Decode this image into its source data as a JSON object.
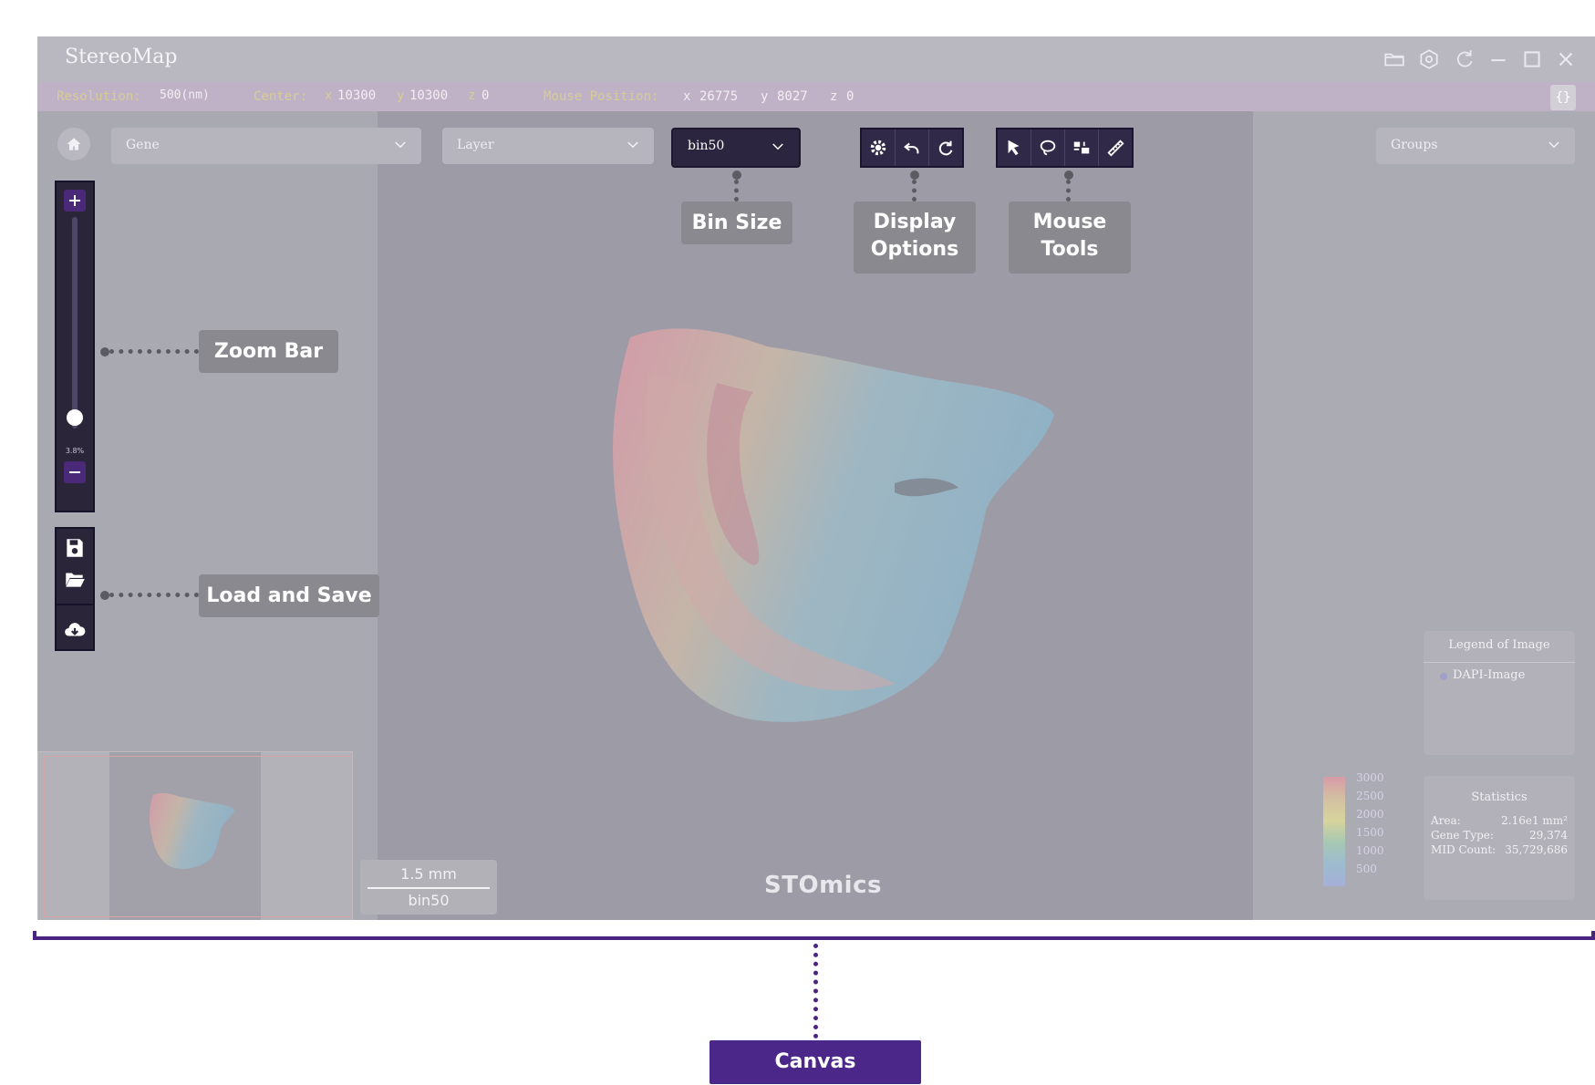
{
  "app": {
    "title": "StereoMap"
  },
  "status": {
    "resolution_label": "Resolution:",
    "resolution_value": "500(nm)",
    "center_label": "Center:",
    "center_x_label": "x",
    "center_x": "10300",
    "center_y_label": "y",
    "center_y": "10300",
    "center_z_label": "z",
    "center_z": "0",
    "mouse_label": "Mouse Position:",
    "mouse_x_label": "x",
    "mouse_x": "26775",
    "mouse_y_label": "y",
    "mouse_y": "8027",
    "mouse_z_label": "z",
    "mouse_z": "0",
    "expand_icon": "{}"
  },
  "toolbar": {
    "gene_label": "Gene",
    "layer_label": "Layer",
    "bin_value": "bin50",
    "groups_label": "Groups"
  },
  "zoom": {
    "percent": "3.8%",
    "level": 0.05
  },
  "scalebar": {
    "length": "1.5 mm",
    "bin": "bin50"
  },
  "wordmark": "STOmics",
  "legend": {
    "title": "Legend of Image",
    "items": [
      "DAPI-Image"
    ]
  },
  "colorbar": {
    "ticks": [
      "3000",
      "2500",
      "2000",
      "1500",
      "1000",
      "500"
    ]
  },
  "statistics": {
    "title": "Statistics",
    "rows": [
      {
        "label": "Area:",
        "value": "2.16e1 mm²"
      },
      {
        "label": "Gene Type:",
        "value": "29,374"
      },
      {
        "label": "MID Count:",
        "value": "35,729,686"
      }
    ]
  },
  "annotations": {
    "bin_size": "Bin Size",
    "display_options_1": "Display",
    "display_options_2": "Options",
    "mouse_tools_1": "Mouse",
    "mouse_tools_2": "Tools",
    "zoom_bar": "Zoom Bar",
    "load_save": "Load and Save",
    "canvas": "Canvas"
  },
  "colors": {
    "accent": "#4b2789",
    "toolbar_dark": "#302a48",
    "status_key": "#d8cc93"
  }
}
